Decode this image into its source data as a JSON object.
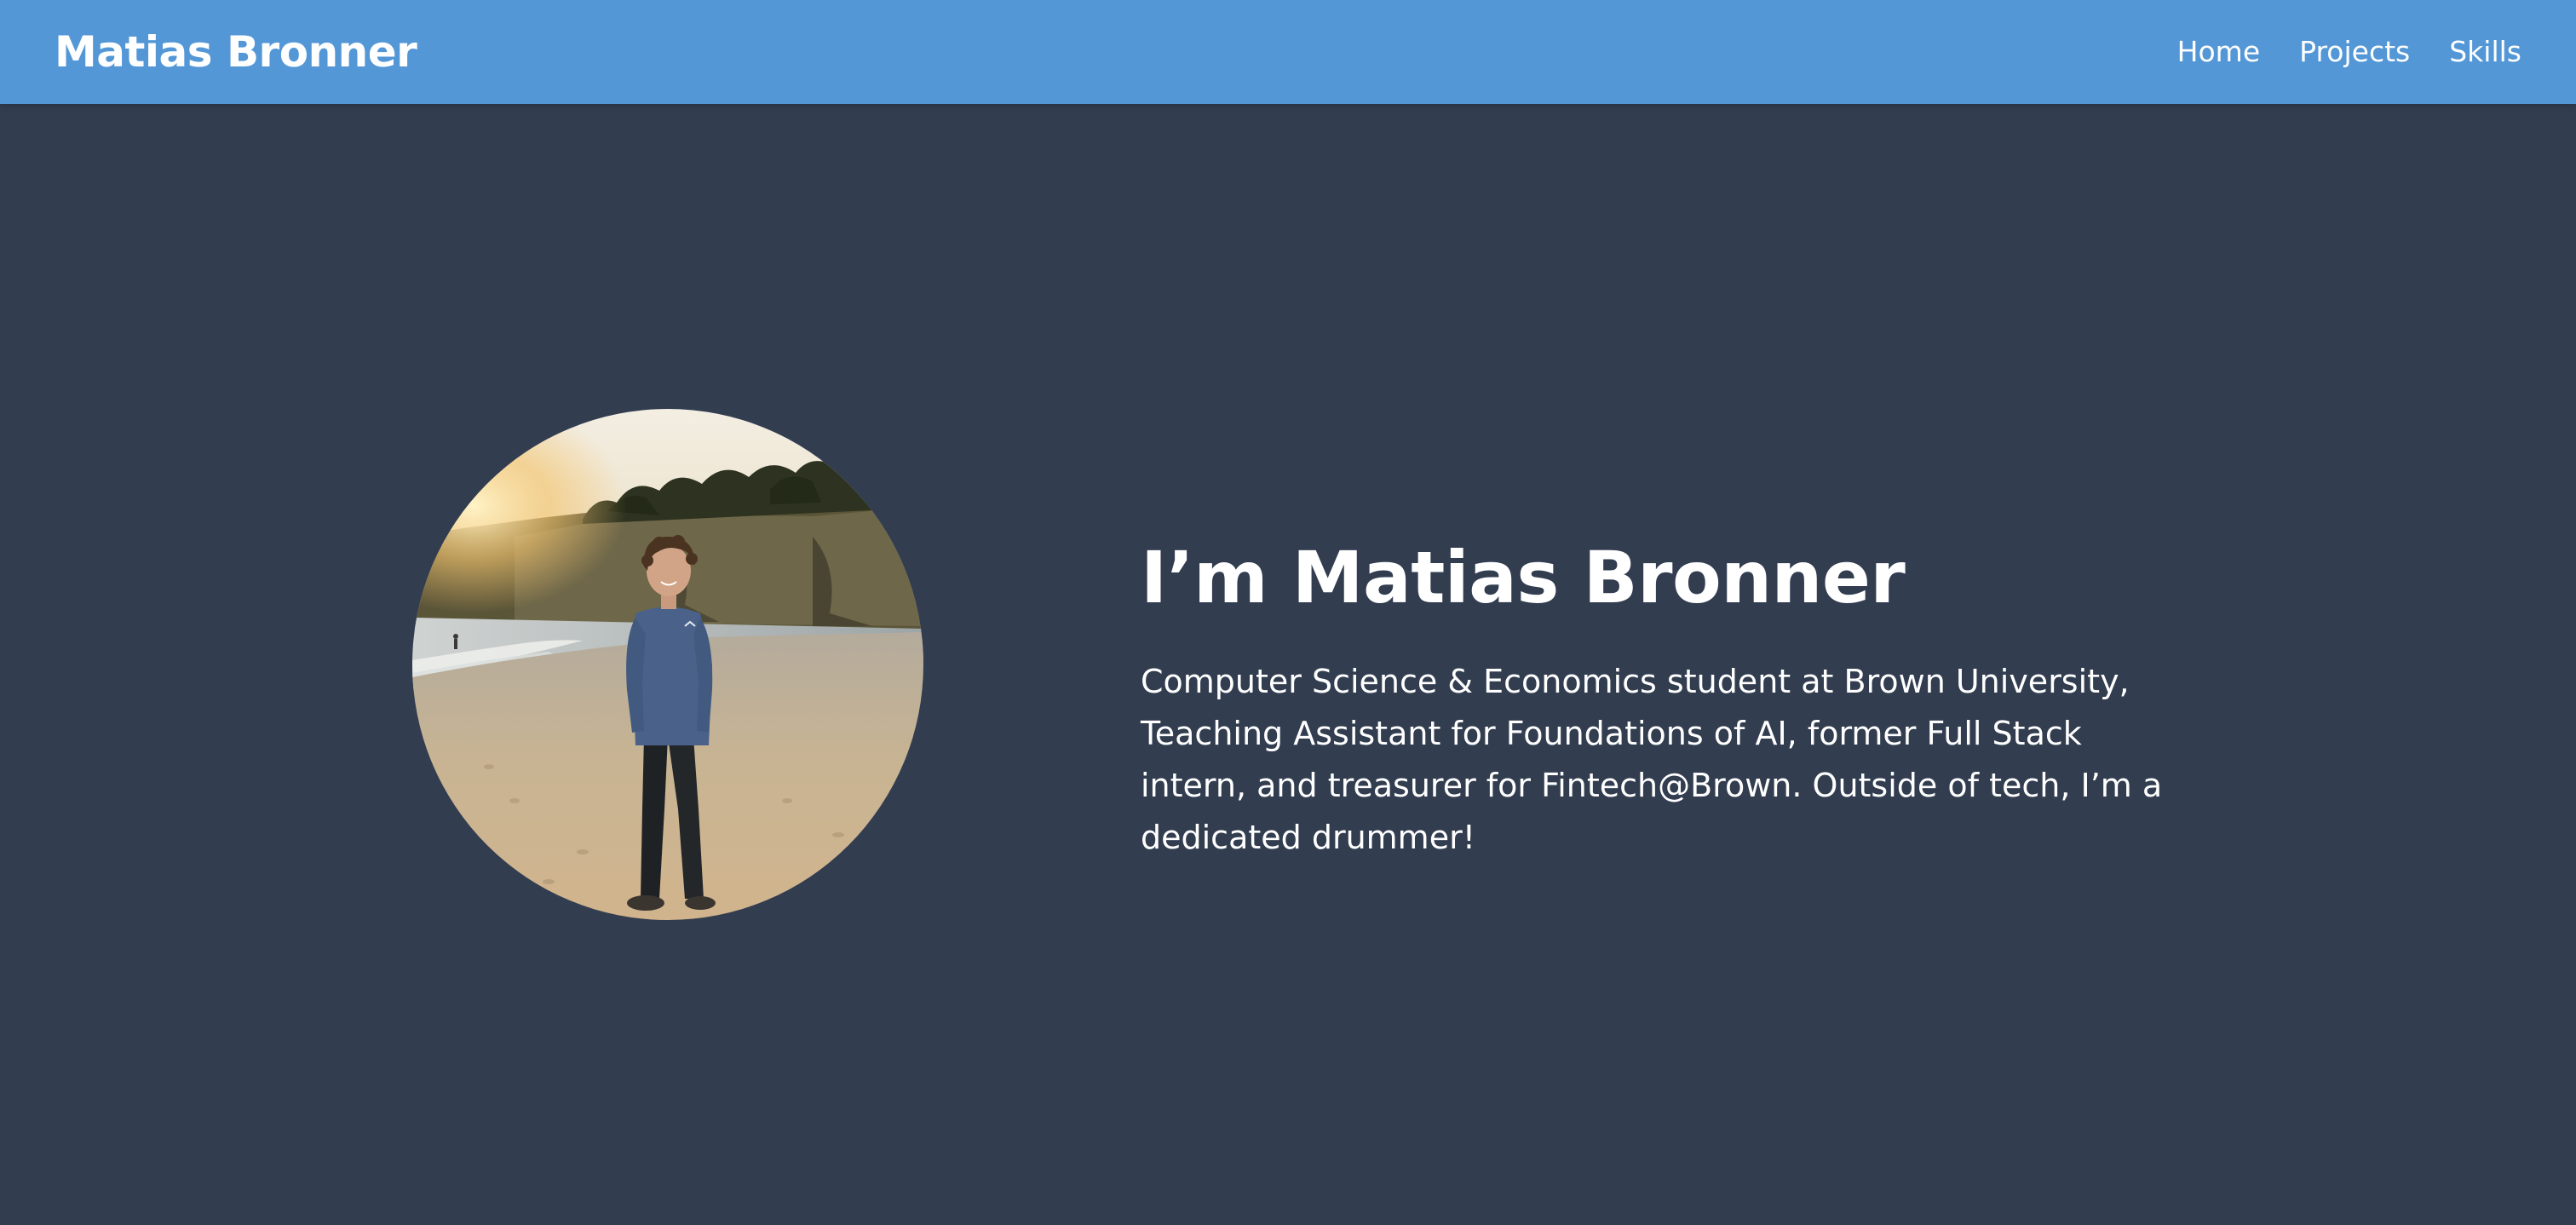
{
  "navbar": {
    "brand": "Matias Bronner",
    "links": [
      {
        "label": "Home"
      },
      {
        "label": "Projects"
      },
      {
        "label": "Skills"
      }
    ]
  },
  "hero": {
    "title": "I’m Matias Bronner",
    "description": "Computer Science & Economics student at Brown University, Teaching Assistant for Foundations of AI, former Full Stack intern, and treasurer for Fintech@Brown. Outside of tech, I’m a dedicated drummer!",
    "photo_alt": "Photo of Matias Bronner on a beach at sunset"
  },
  "colors": {
    "navbar": "#5397d6",
    "background": "#323d50",
    "text": "#ffffff"
  }
}
